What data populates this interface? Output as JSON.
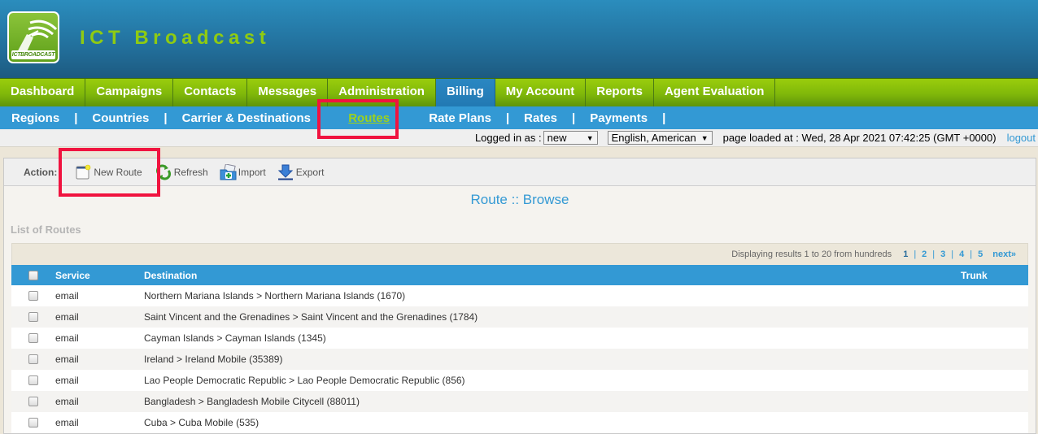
{
  "brand": {
    "logo_text": "ICTBROADCAST",
    "title": "ICT Broadcast"
  },
  "main_nav": [
    {
      "label": "Dashboard",
      "active": false
    },
    {
      "label": "Campaigns",
      "active": false
    },
    {
      "label": "Contacts",
      "active": false
    },
    {
      "label": "Messages",
      "active": false
    },
    {
      "label": "Administration",
      "active": false
    },
    {
      "label": "Billing",
      "active": true
    },
    {
      "label": "My Account",
      "active": false
    },
    {
      "label": "Reports",
      "active": false
    },
    {
      "label": "Agent Evaluation",
      "active": false
    }
  ],
  "sub_nav": [
    {
      "label": "Regions",
      "active": false
    },
    {
      "label": "Countries",
      "active": false
    },
    {
      "label": "Carrier & Destinations",
      "active": false
    },
    {
      "label": "Routes",
      "active": true
    },
    {
      "label": "Rate Plans",
      "active": false
    },
    {
      "label": "Rates",
      "active": false
    },
    {
      "label": "Payments",
      "active": false
    }
  ],
  "info_bar": {
    "logged_in_label": "Logged in as :",
    "user_value": "new",
    "language_value": "English, American",
    "page_loaded_text": "page loaded at : Wed, 28 Apr 2021 07:42:25 (GMT +0000)",
    "logout_label": "logout"
  },
  "actions": {
    "label": "Action:",
    "new_route": "New Route",
    "refresh": "Refresh",
    "import": "Import",
    "export": "Export"
  },
  "page_title": "Route :: Browse",
  "list_label": "List of Routes",
  "pager": {
    "summary": "Displaying results 1 to 20 from hundreds",
    "pages": [
      "1",
      "2",
      "3",
      "4",
      "5"
    ],
    "current": "1",
    "next_label": "next»"
  },
  "table": {
    "columns": {
      "service": "Service",
      "destination": "Destination",
      "trunk": "Trunk"
    },
    "rows": [
      {
        "service": "email",
        "destination": "Northern Mariana Islands > Northern Mariana Islands (1670)",
        "trunk": ""
      },
      {
        "service": "email",
        "destination": "Saint Vincent and the Grenadines > Saint Vincent and the Grenadines (1784)",
        "trunk": ""
      },
      {
        "service": "email",
        "destination": "Cayman Islands > Cayman Islands (1345)",
        "trunk": ""
      },
      {
        "service": "email",
        "destination": "Ireland > Ireland Mobile (35389)",
        "trunk": ""
      },
      {
        "service": "email",
        "destination": "Lao People Democratic Republic > Lao People Democratic Republic (856)",
        "trunk": ""
      },
      {
        "service": "email",
        "destination": "Bangladesh > Bangladesh Mobile Citycell (88011)",
        "trunk": ""
      },
      {
        "service": "email",
        "destination": "Cuba > Cuba Mobile (535)",
        "trunk": ""
      }
    ]
  },
  "colors": {
    "brand_green": "#8fcb12",
    "nav_blue": "#3399d4",
    "highlight_red": "#f0133f"
  }
}
